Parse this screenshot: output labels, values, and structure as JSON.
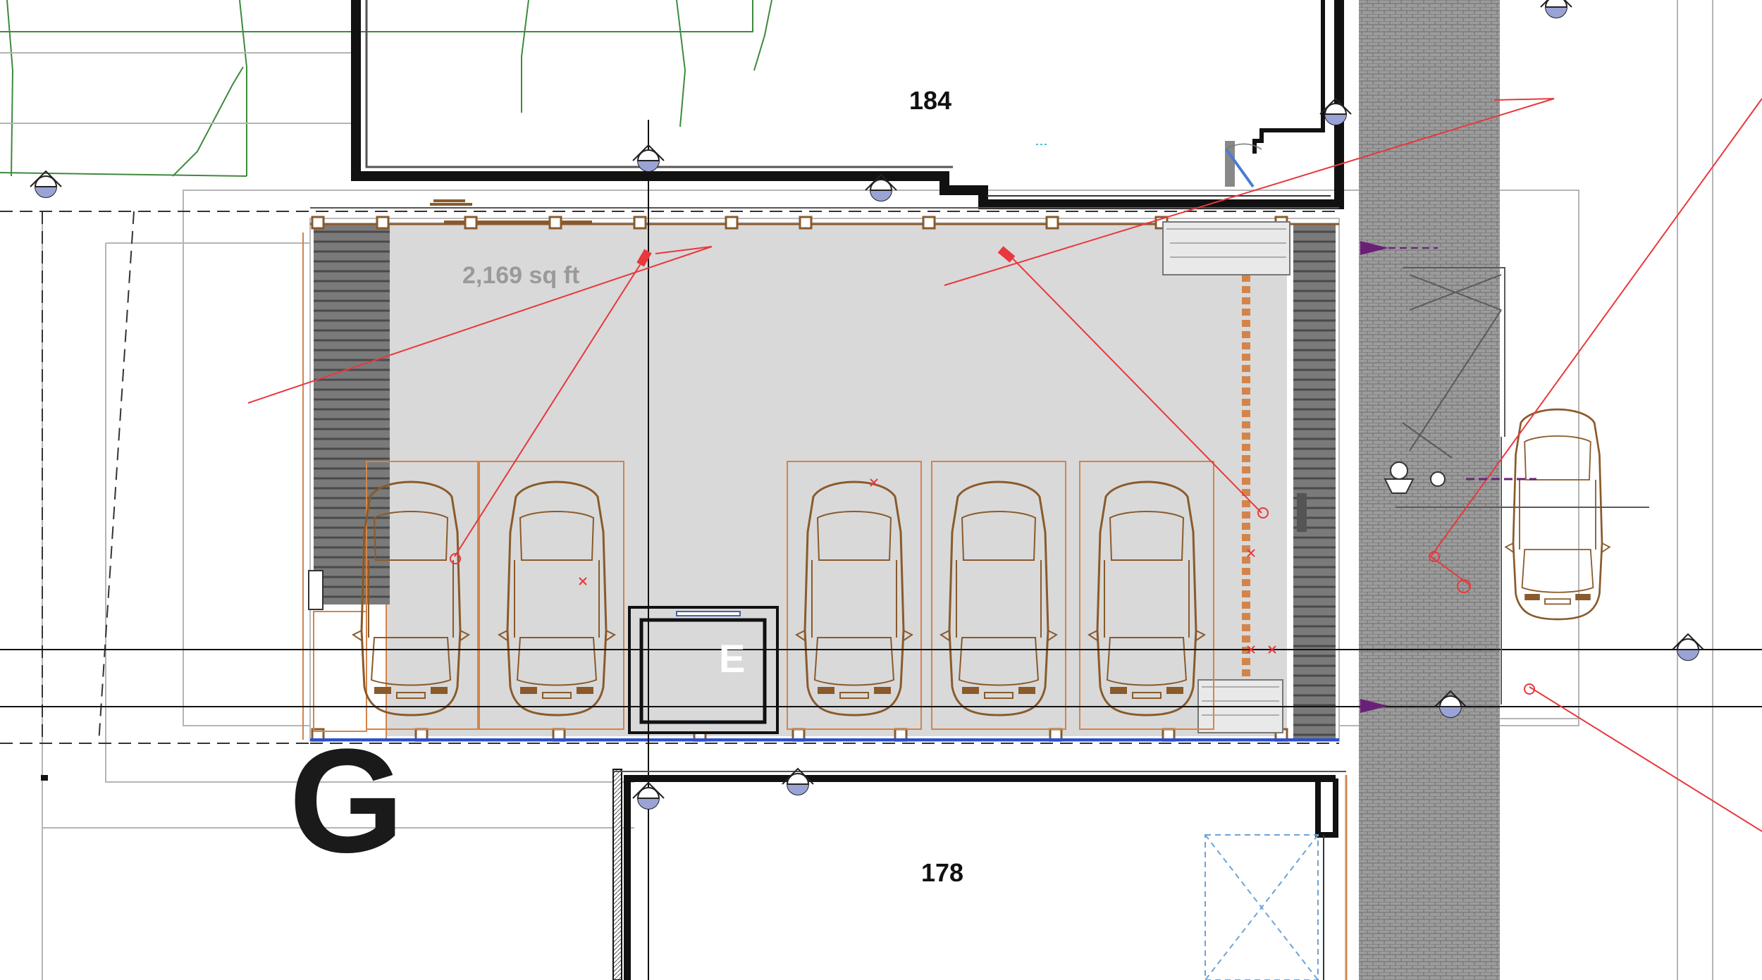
{
  "plan": {
    "room_tags": {
      "north_unit": "184",
      "south_unit": "178"
    },
    "area_label": "2,169 sq ft",
    "grid_bubble": "G",
    "elevator_label": "E",
    "colors": {
      "floor": "#d9d9d9",
      "wall": "#111111",
      "car": "#8a5a2b",
      "annotation": "#e8383d",
      "parking_outline": "#d4844a",
      "dimension_marker": "#6b2077",
      "hatch": "#8c8c8c",
      "ramp": "#5a5a5a",
      "blue_line": "#2a4fd0",
      "landscape": "#3d8a3d"
    },
    "icons": [
      "section-marker-icon",
      "elevation-arrow-icon",
      "car-icon",
      "person-icon"
    ]
  }
}
